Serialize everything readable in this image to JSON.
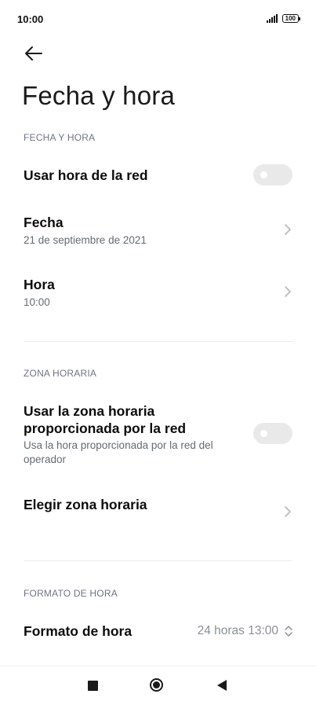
{
  "status": {
    "time": "10:00",
    "battery": "100"
  },
  "page": {
    "title": "Fecha y hora"
  },
  "sections": {
    "date_time": "FECHA Y HORA",
    "time_zone": "ZONA HORARIA",
    "time_format": "FORMATO DE HORA"
  },
  "items": {
    "network_time": {
      "label": "Usar hora de la red",
      "enabled": false
    },
    "date": {
      "label": "Fecha",
      "value": "21 de septiembre de 2021"
    },
    "time": {
      "label": "Hora",
      "value": "10:00"
    },
    "network_zone": {
      "label_line1": "Usar la zona horaria",
      "label_line2": "proporcionada por la red",
      "desc_line1": "Usa la hora proporcionada por la red del",
      "desc_line2": "operador",
      "enabled": false
    },
    "choose_zone": {
      "label": "Elegir zona horaria"
    },
    "format": {
      "label": "Formato de hora",
      "value": "24 horas 13:00"
    }
  },
  "icons": {
    "back": "arrow-left-icon",
    "chevron": "chevron-right-icon",
    "updown": "chevron-up-down-icon",
    "nav": [
      "square-icon",
      "circle-icon",
      "triangle-back-icon"
    ]
  },
  "colors": {
    "accent_toggle_off": "#e9e9ea",
    "section_text": "#6f7480"
  }
}
